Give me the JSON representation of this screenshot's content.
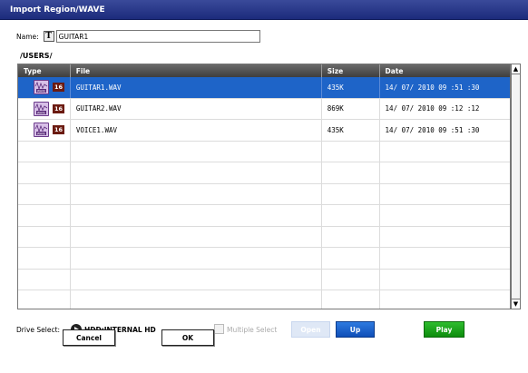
{
  "dialog": {
    "title": "Import Region/WAVE"
  },
  "name_field": {
    "label": "Name:",
    "t_button": "T",
    "value": "GUITAR1"
  },
  "path": "/USERS/",
  "table": {
    "columns": [
      "Type",
      "File",
      "Size",
      "Date"
    ],
    "rows": [
      {
        "type_icon": "wave-file-icon",
        "bits": "16",
        "file": "GUITAR1.WAV",
        "size": "435K",
        "date": "14/ 07/ 2010   09 :51 :30",
        "selected": true
      },
      {
        "type_icon": "wave-file-icon",
        "bits": "16",
        "file": "GUITAR2.WAV",
        "size": "869K",
        "date": "14/ 07/ 2010   09 :12 :12",
        "selected": false
      },
      {
        "type_icon": "wave-file-icon",
        "bits": "16",
        "file": "VOICE1.WAV",
        "size": "435K",
        "date": "14/ 07/ 2010   09 :51 :30",
        "selected": false
      }
    ],
    "empty_rows": 8
  },
  "drive": {
    "label": "Drive Select:",
    "value": "HDD:INTERNAL HD"
  },
  "multiple_select": {
    "label": "Multiple Select",
    "checked": false,
    "enabled": false
  },
  "buttons": {
    "open": "Open",
    "up": "Up",
    "play": "Play",
    "cancel": "Cancel",
    "ok": "OK"
  },
  "colors": {
    "selection": "#1e64c8",
    "titlebar": "#1c2b7c",
    "play": "#0d8c0d",
    "up": "#0f4fb8"
  }
}
